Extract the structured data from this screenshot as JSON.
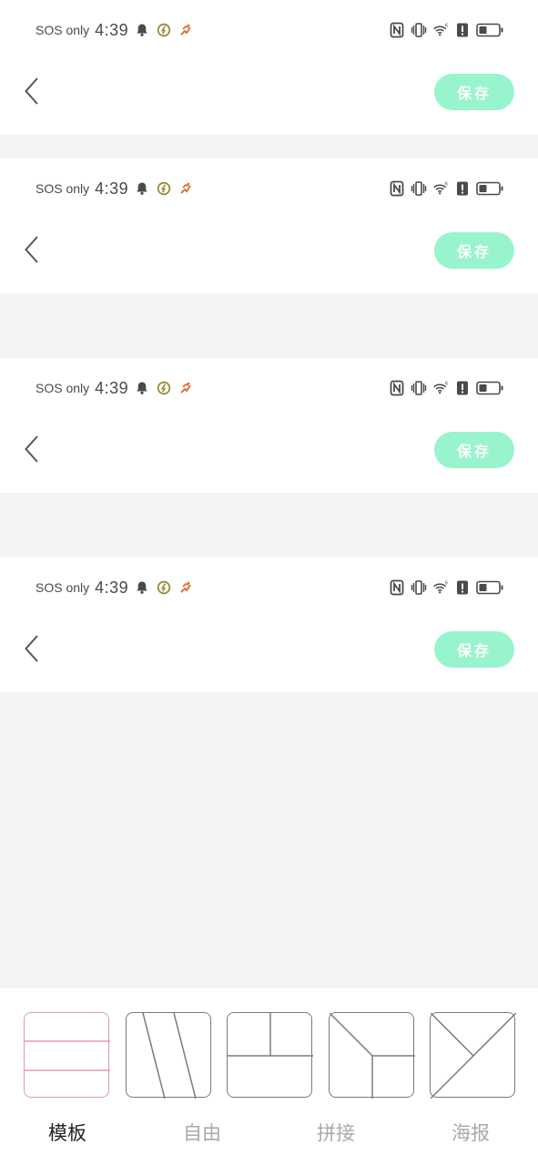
{
  "status_bar": {
    "carrier": "SOS only",
    "time": "4:39",
    "icons": [
      "bell-icon",
      "app-circle-icon",
      "runner-icon",
      "nfc-icon",
      "vibrate-icon",
      "wifi-icon",
      "alert-icon",
      "battery-icon"
    ]
  },
  "nav": {
    "back_icon": "chevron-left-icon",
    "save_label": "保存"
  },
  "colors": {
    "save_button_bg": "#98f4cc",
    "active_thumb_border": "#e39aa5",
    "active_tab": "#222222",
    "inactive_tab": "#a9a9a9",
    "background": "#f4f4f4"
  },
  "bottom_tabs": [
    {
      "label": "模板",
      "active": true
    },
    {
      "label": "自由",
      "active": false
    },
    {
      "label": "拼接",
      "active": false
    },
    {
      "label": "海报",
      "active": false
    }
  ],
  "layout_thumbnails": [
    {
      "icon": "layout-three-rows-icon",
      "selected": true
    },
    {
      "icon": "layout-diagonal-strips-icon",
      "selected": false
    },
    {
      "icon": "layout-grid-split-icon",
      "selected": false
    },
    {
      "icon": "layout-y-split-icon",
      "selected": false
    },
    {
      "icon": "layout-x-split-icon",
      "selected": false
    }
  ]
}
